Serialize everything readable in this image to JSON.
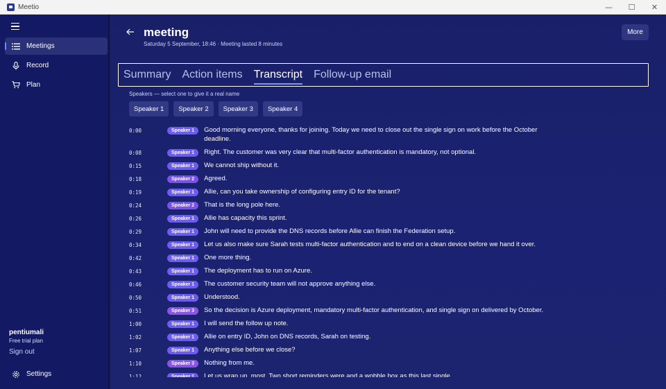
{
  "window": {
    "title": "Meetio",
    "controls": {
      "minimize": "—",
      "maximize": "☐",
      "close": "✕"
    }
  },
  "sidebar": {
    "items": [
      {
        "label": "Meetings",
        "icon": "list-icon",
        "active": true
      },
      {
        "label": "Record",
        "icon": "microphone-icon",
        "active": false
      },
      {
        "label": "Plan",
        "icon": "cart-icon",
        "active": false
      }
    ],
    "user": {
      "name": "pentiumali",
      "plan": "Free trial plan",
      "sign_out": "Sign out"
    },
    "settings_label": "Settings"
  },
  "header": {
    "title": "meeting",
    "subtitle": "Saturday 5 September, 18:46 · Meeting lasted 8 minutes",
    "more_label": "More"
  },
  "tabs": [
    {
      "label": "Summary",
      "active": false
    },
    {
      "label": "Action items",
      "active": false
    },
    {
      "label": "Transcript",
      "active": true
    },
    {
      "label": "Follow-up email",
      "active": false
    }
  ],
  "speakers": {
    "hint": "Speakers — select one to give it a real name",
    "chips": [
      "Speaker 1",
      "Speaker 2",
      "Speaker 3",
      "Speaker 4"
    ]
  },
  "transcript": [
    {
      "time": "0:00",
      "speaker": "Speaker 1",
      "text": "Good morning everyone, thanks for joining. Today we need to close out the single sign on work before the October deadline."
    },
    {
      "time": "0:08",
      "speaker": "Speaker 1",
      "text": "Right. The customer was very clear that multi-factor authentication is mandatory, not optional."
    },
    {
      "time": "0:15",
      "speaker": "Speaker 1",
      "text": "We cannot ship without it."
    },
    {
      "time": "0:18",
      "speaker": "Speaker 2",
      "text": "Agreed."
    },
    {
      "time": "0:19",
      "speaker": "Speaker 1",
      "text": "Allie, can you take ownership of configuring entry ID for the tenant?"
    },
    {
      "time": "0:24",
      "speaker": "Speaker 2",
      "text": "That is the long pole here."
    },
    {
      "time": "0:26",
      "speaker": "Speaker 1",
      "text": "Allie has capacity this sprint."
    },
    {
      "time": "0:29",
      "speaker": "Speaker 1",
      "text": "John will need to provide the DNS records before Allie can finish the Federation setup."
    },
    {
      "time": "0:34",
      "speaker": "Speaker 1",
      "text": "Let us also make sure Sarah tests multi-factor authentication and to end on a clean device before we hand it over."
    },
    {
      "time": "0:42",
      "speaker": "Speaker 1",
      "text": "One more thing."
    },
    {
      "time": "0:43",
      "speaker": "Speaker 1",
      "text": "The deployment has to run on Azure."
    },
    {
      "time": "0:46",
      "speaker": "Speaker 1",
      "text": "The customer security team will not approve anything else."
    },
    {
      "time": "0:50",
      "speaker": "Speaker 1",
      "text": "Understood."
    },
    {
      "time": "0:51",
      "speaker": "Speaker 3",
      "text": "So the decision is Azure deployment, mandatory multi-factor authentication, and single sign on delivered by October."
    },
    {
      "time": "1:00",
      "speaker": "Speaker 1",
      "text": "I will send the follow up note."
    },
    {
      "time": "1:02",
      "speaker": "Speaker 1",
      "text": "Allie on entry ID, John on DNS records, Sarah on testing."
    },
    {
      "time": "1:07",
      "speaker": "Speaker 1",
      "text": "Anything else before we close?"
    },
    {
      "time": "1:10",
      "speaker": "Speaker 3",
      "text": "Nothing from me."
    },
    {
      "time": "1:12",
      "speaker": "Speaker 1",
      "text": "Let us wrap up, most. Two short reminders were and a wobble box as this last single."
    }
  ]
}
